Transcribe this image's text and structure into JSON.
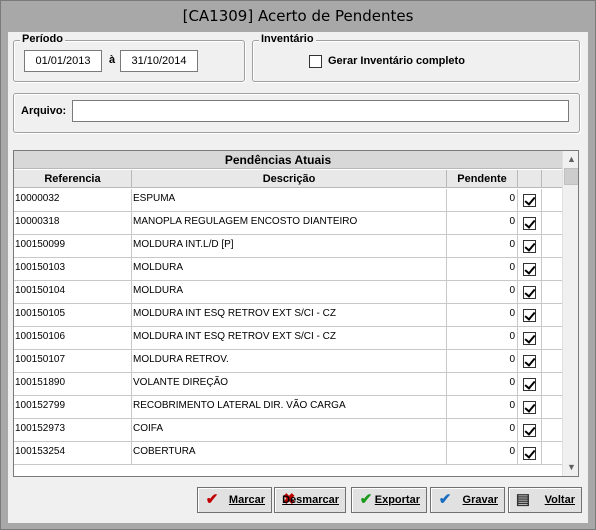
{
  "window": {
    "title": "[CA1309] Acerto de Pendentes"
  },
  "periodo": {
    "legend": "Período",
    "start": "01/01/2013",
    "sep": "à",
    "end": "31/10/2014"
  },
  "inventario": {
    "legend": "Inventário",
    "checkbox_label": "Gerar Inventário completo",
    "checked": false
  },
  "arquivo": {
    "label": "Arquivo:",
    "value": ""
  },
  "grid": {
    "title": "Pendências Atuais",
    "columns": [
      "Referencia",
      "Descrição",
      "Pendente"
    ],
    "rows": [
      {
        "ref": "10000032",
        "desc": "ESPUMA",
        "pend": "0",
        "checked": true
      },
      {
        "ref": "10000318",
        "desc": "MANOPLA REGULAGEM ENCOSTO DIANTEIRO",
        "pend": "0",
        "checked": true
      },
      {
        "ref": "100150099",
        "desc": "MOLDURA INT.L/D [P]",
        "pend": "0",
        "checked": true
      },
      {
        "ref": "100150103",
        "desc": "MOLDURA",
        "pend": "0",
        "checked": true
      },
      {
        "ref": "100150104",
        "desc": "MOLDURA",
        "pend": "0",
        "checked": true
      },
      {
        "ref": "100150105",
        "desc": "MOLDURA INT ESQ RETROV EXT S/CI - CZ",
        "pend": "0",
        "checked": true
      },
      {
        "ref": "100150106",
        "desc": "MOLDURA INT ESQ RETROV EXT S/CI - CZ",
        "pend": "0",
        "checked": true
      },
      {
        "ref": "100150107",
        "desc": "MOLDURA RETROV.",
        "pend": "0",
        "checked": true
      },
      {
        "ref": "100151890",
        "desc": "VOLANTE DIREÇÃO",
        "pend": "0",
        "checked": true
      },
      {
        "ref": "100152799",
        "desc": "RECOBRIMENTO LATERAL DIR. VÃO CARGA",
        "pend": "0",
        "checked": true
      },
      {
        "ref": "100152973",
        "desc": "COIFA",
        "pend": "0",
        "checked": true
      },
      {
        "ref": "100153254",
        "desc": "COBERTURA",
        "pend": "0",
        "checked": true
      }
    ]
  },
  "buttons": {
    "marcar": "Marcar",
    "desmarcar": "Desmarcar",
    "exportar": "Exportar",
    "gravar": "Gravar",
    "voltar": "Voltar"
  },
  "icons": {
    "marcar": "check-x-icon",
    "desmarcar": "uncheck-icon",
    "exportar": "export-check-icon",
    "gravar": "save-check-icon",
    "voltar": "exit-icon"
  }
}
